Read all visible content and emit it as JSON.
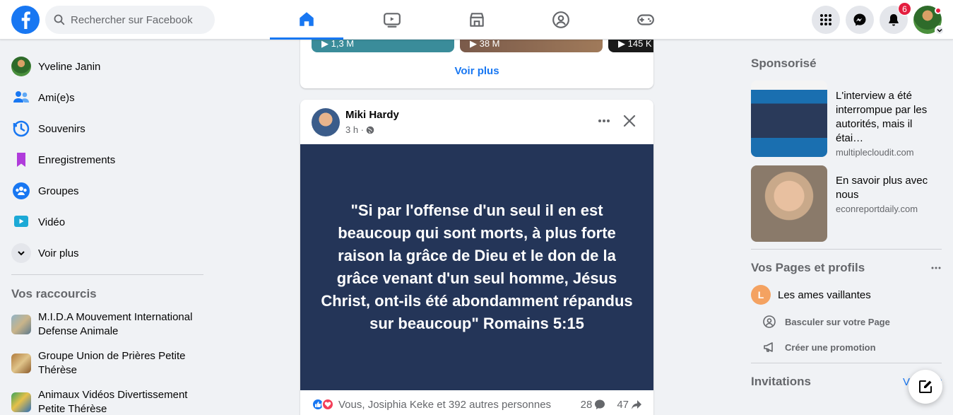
{
  "search": {
    "placeholder": "Rechercher sur Facebook"
  },
  "notifications": {
    "count": "6"
  },
  "sidebar": {
    "items": [
      {
        "label": "Yveline Janin"
      },
      {
        "label": "Ami(e)s"
      },
      {
        "label": "Souvenirs"
      },
      {
        "label": "Enregistrements"
      },
      {
        "label": "Groupes"
      },
      {
        "label": "Vidéo"
      },
      {
        "label": "Voir plus"
      }
    ],
    "shortcuts_title": "Vos raccourcis",
    "shortcuts": [
      {
        "label": "M.I.D.A Mouvement International Defense Animale"
      },
      {
        "label": "Groupe Union de Prières Petite Thérèse"
      },
      {
        "label": "Animaux Vidéos Divertissement Petite Thérèse"
      }
    ]
  },
  "reels": [
    {
      "views": "▶ 1,3 M"
    },
    {
      "views": "▶ 38 M"
    },
    {
      "views": "▶ 145 K"
    }
  ],
  "reels_more": "Voir plus",
  "post": {
    "author": "Miki Hardy",
    "time": "3 h ·",
    "quote": "\"Si par l'offense d'un seul il en est beaucoup qui sont morts, à plus forte raison la grâce de Dieu et le don de la grâce venant d'un seul homme, Jésus Christ, ont-ils été abondamment répandus sur beaucoup\" Romains 5:15",
    "reactions_text": "Vous, Josiphia Keke et 392 autres personnes",
    "comments": "28",
    "shares": "47"
  },
  "right": {
    "sponsored_title": "Sponsorisé",
    "ads": [
      {
        "text": "L'interview a été interrompue par les autorités, mais il étai…",
        "domain": "multiplecloudit.com"
      },
      {
        "text": "En savoir plus avec nous",
        "domain": "econreportdaily.com"
      }
    ],
    "pages_title": "Vos Pages et profils",
    "page_initial": "L",
    "page_name": "Les ames vaillantes",
    "switch_label": "Basculer sur votre Page",
    "promo_label": "Créer une promotion",
    "invitations_title": "Invitations",
    "invitations_link": "Voir tout"
  },
  "colors": {
    "brand": "#1877f2",
    "quote_bg": "#243558",
    "badge": "#e41e3f"
  }
}
